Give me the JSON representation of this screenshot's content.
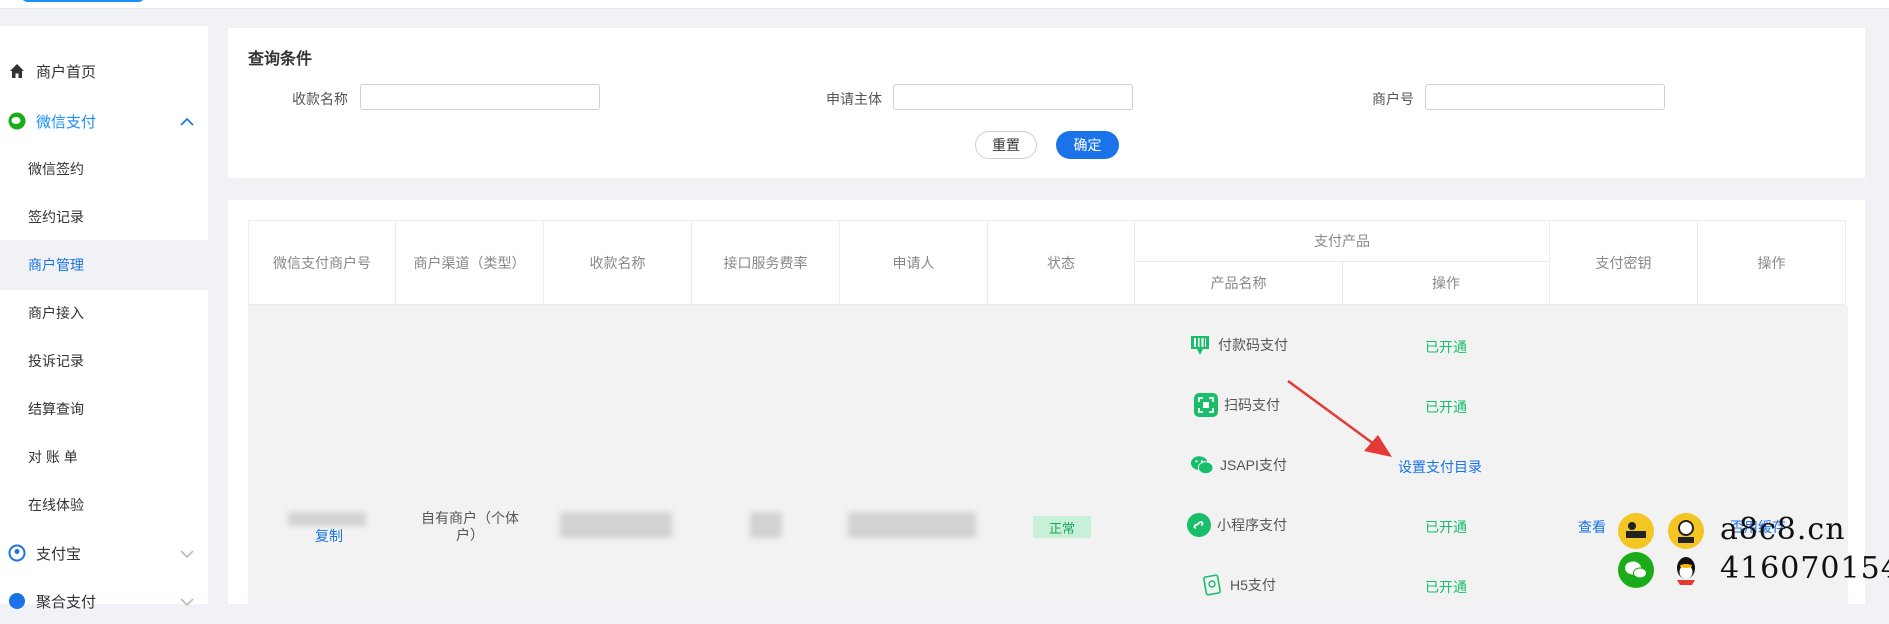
{
  "sidebar": {
    "items": [
      {
        "label": "商户首页",
        "icon": "home-icon"
      },
      {
        "label": "微信支付",
        "icon": "wechat-icon"
      },
      {
        "label": "微信签约"
      },
      {
        "label": "签约记录"
      },
      {
        "label": "商户管理"
      },
      {
        "label": "商户接入"
      },
      {
        "label": "投诉记录"
      },
      {
        "label": "结算查询"
      },
      {
        "label": "对 账 单"
      },
      {
        "label": "在线体验"
      },
      {
        "label": "支付宝",
        "icon": "alipay-icon"
      },
      {
        "label": "聚合支付",
        "icon": "aggregate-icon"
      }
    ]
  },
  "query": {
    "title": "查询条件",
    "fields": [
      {
        "label": "收款名称",
        "value": ""
      },
      {
        "label": "申请主体",
        "value": ""
      },
      {
        "label": "商户号",
        "value": ""
      }
    ],
    "reset_label": "重置",
    "confirm_label": "确定"
  },
  "table": {
    "headers": {
      "mch_no": "微信支付商户号",
      "channel": "商户渠道（类型）",
      "payee": "收款名称",
      "fee": "接口服务费率",
      "applicant": "申请人",
      "status": "状态",
      "products": "支付产品",
      "product_name": "产品名称",
      "product_op": "操作",
      "secret": "支付密钥",
      "op": "操作"
    },
    "row": {
      "copy_label": "复制",
      "channel": "自有商户（个体户）",
      "status": "正常",
      "products": [
        {
          "name": "付款码支付",
          "op": "已开通",
          "icon": "barcode-pay-icon"
        },
        {
          "name": "扫码支付",
          "op": "已开通",
          "icon": "scan-pay-icon"
        },
        {
          "name": "JSAPI支付",
          "op": "设置支付目录",
          "icon": "jsapi-wechat-icon"
        },
        {
          "name": "小程序支付",
          "op": "已开通",
          "icon": "miniprogram-icon"
        },
        {
          "name": "H5支付",
          "op": "已开通",
          "icon": "h5-pay-icon"
        }
      ],
      "view_label": "查看",
      "op_text": "否用缓存"
    }
  },
  "watermark": {
    "site": "a8c8.cn",
    "qq": "416070154"
  },
  "colors": {
    "accent": "#1a73e8",
    "success": "#19be6b",
    "annotation_arrow": "#e53935"
  }
}
